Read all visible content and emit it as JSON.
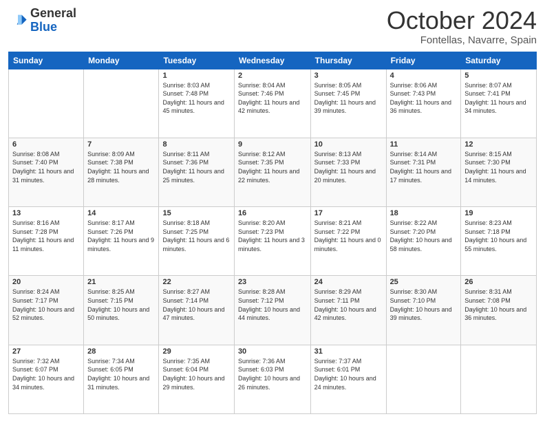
{
  "header": {
    "logo_general": "General",
    "logo_blue": "Blue",
    "month_title": "October 2024",
    "location": "Fontellas, Navarre, Spain"
  },
  "weekdays": [
    "Sunday",
    "Monday",
    "Tuesday",
    "Wednesday",
    "Thursday",
    "Friday",
    "Saturday"
  ],
  "weeks": [
    [
      {
        "day": "",
        "content": ""
      },
      {
        "day": "",
        "content": ""
      },
      {
        "day": "1",
        "content": "Sunrise: 8:03 AM\nSunset: 7:48 PM\nDaylight: 11 hours and 45 minutes."
      },
      {
        "day": "2",
        "content": "Sunrise: 8:04 AM\nSunset: 7:46 PM\nDaylight: 11 hours and 42 minutes."
      },
      {
        "day": "3",
        "content": "Sunrise: 8:05 AM\nSunset: 7:45 PM\nDaylight: 11 hours and 39 minutes."
      },
      {
        "day": "4",
        "content": "Sunrise: 8:06 AM\nSunset: 7:43 PM\nDaylight: 11 hours and 36 minutes."
      },
      {
        "day": "5",
        "content": "Sunrise: 8:07 AM\nSunset: 7:41 PM\nDaylight: 11 hours and 34 minutes."
      }
    ],
    [
      {
        "day": "6",
        "content": "Sunrise: 8:08 AM\nSunset: 7:40 PM\nDaylight: 11 hours and 31 minutes."
      },
      {
        "day": "7",
        "content": "Sunrise: 8:09 AM\nSunset: 7:38 PM\nDaylight: 11 hours and 28 minutes."
      },
      {
        "day": "8",
        "content": "Sunrise: 8:11 AM\nSunset: 7:36 PM\nDaylight: 11 hours and 25 minutes."
      },
      {
        "day": "9",
        "content": "Sunrise: 8:12 AM\nSunset: 7:35 PM\nDaylight: 11 hours and 22 minutes."
      },
      {
        "day": "10",
        "content": "Sunrise: 8:13 AM\nSunset: 7:33 PM\nDaylight: 11 hours and 20 minutes."
      },
      {
        "day": "11",
        "content": "Sunrise: 8:14 AM\nSunset: 7:31 PM\nDaylight: 11 hours and 17 minutes."
      },
      {
        "day": "12",
        "content": "Sunrise: 8:15 AM\nSunset: 7:30 PM\nDaylight: 11 hours and 14 minutes."
      }
    ],
    [
      {
        "day": "13",
        "content": "Sunrise: 8:16 AM\nSunset: 7:28 PM\nDaylight: 11 hours and 11 minutes."
      },
      {
        "day": "14",
        "content": "Sunrise: 8:17 AM\nSunset: 7:26 PM\nDaylight: 11 hours and 9 minutes."
      },
      {
        "day": "15",
        "content": "Sunrise: 8:18 AM\nSunset: 7:25 PM\nDaylight: 11 hours and 6 minutes."
      },
      {
        "day": "16",
        "content": "Sunrise: 8:20 AM\nSunset: 7:23 PM\nDaylight: 11 hours and 3 minutes."
      },
      {
        "day": "17",
        "content": "Sunrise: 8:21 AM\nSunset: 7:22 PM\nDaylight: 11 hours and 0 minutes."
      },
      {
        "day": "18",
        "content": "Sunrise: 8:22 AM\nSunset: 7:20 PM\nDaylight: 10 hours and 58 minutes."
      },
      {
        "day": "19",
        "content": "Sunrise: 8:23 AM\nSunset: 7:18 PM\nDaylight: 10 hours and 55 minutes."
      }
    ],
    [
      {
        "day": "20",
        "content": "Sunrise: 8:24 AM\nSunset: 7:17 PM\nDaylight: 10 hours and 52 minutes."
      },
      {
        "day": "21",
        "content": "Sunrise: 8:25 AM\nSunset: 7:15 PM\nDaylight: 10 hours and 50 minutes."
      },
      {
        "day": "22",
        "content": "Sunrise: 8:27 AM\nSunset: 7:14 PM\nDaylight: 10 hours and 47 minutes."
      },
      {
        "day": "23",
        "content": "Sunrise: 8:28 AM\nSunset: 7:12 PM\nDaylight: 10 hours and 44 minutes."
      },
      {
        "day": "24",
        "content": "Sunrise: 8:29 AM\nSunset: 7:11 PM\nDaylight: 10 hours and 42 minutes."
      },
      {
        "day": "25",
        "content": "Sunrise: 8:30 AM\nSunset: 7:10 PM\nDaylight: 10 hours and 39 minutes."
      },
      {
        "day": "26",
        "content": "Sunrise: 8:31 AM\nSunset: 7:08 PM\nDaylight: 10 hours and 36 minutes."
      }
    ],
    [
      {
        "day": "27",
        "content": "Sunrise: 7:32 AM\nSunset: 6:07 PM\nDaylight: 10 hours and 34 minutes."
      },
      {
        "day": "28",
        "content": "Sunrise: 7:34 AM\nSunset: 6:05 PM\nDaylight: 10 hours and 31 minutes."
      },
      {
        "day": "29",
        "content": "Sunrise: 7:35 AM\nSunset: 6:04 PM\nDaylight: 10 hours and 29 minutes."
      },
      {
        "day": "30",
        "content": "Sunrise: 7:36 AM\nSunset: 6:03 PM\nDaylight: 10 hours and 26 minutes."
      },
      {
        "day": "31",
        "content": "Sunrise: 7:37 AM\nSunset: 6:01 PM\nDaylight: 10 hours and 24 minutes."
      },
      {
        "day": "",
        "content": ""
      },
      {
        "day": "",
        "content": ""
      }
    ]
  ]
}
